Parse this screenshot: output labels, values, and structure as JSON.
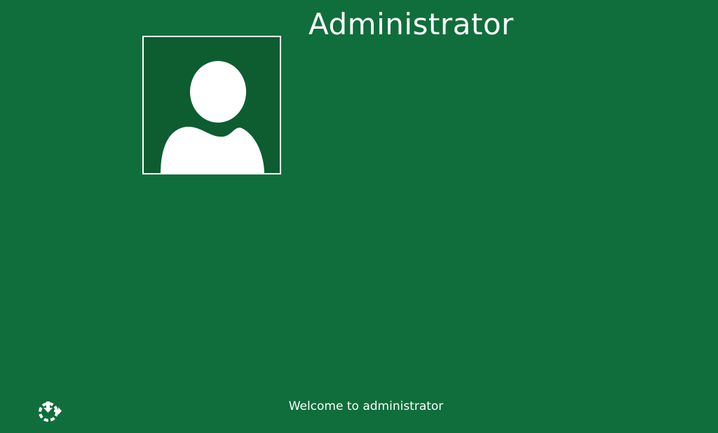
{
  "login": {
    "user_name": "Administrator",
    "welcome_message": "Welcome to administrator"
  },
  "icons": {
    "avatar": "user-silhouette-icon",
    "ease_of_access": "ease-of-access-icon"
  },
  "colors": {
    "background": "#0f6e3b",
    "avatar_tile": "#0d5d31",
    "foreground": "#ffffff"
  }
}
